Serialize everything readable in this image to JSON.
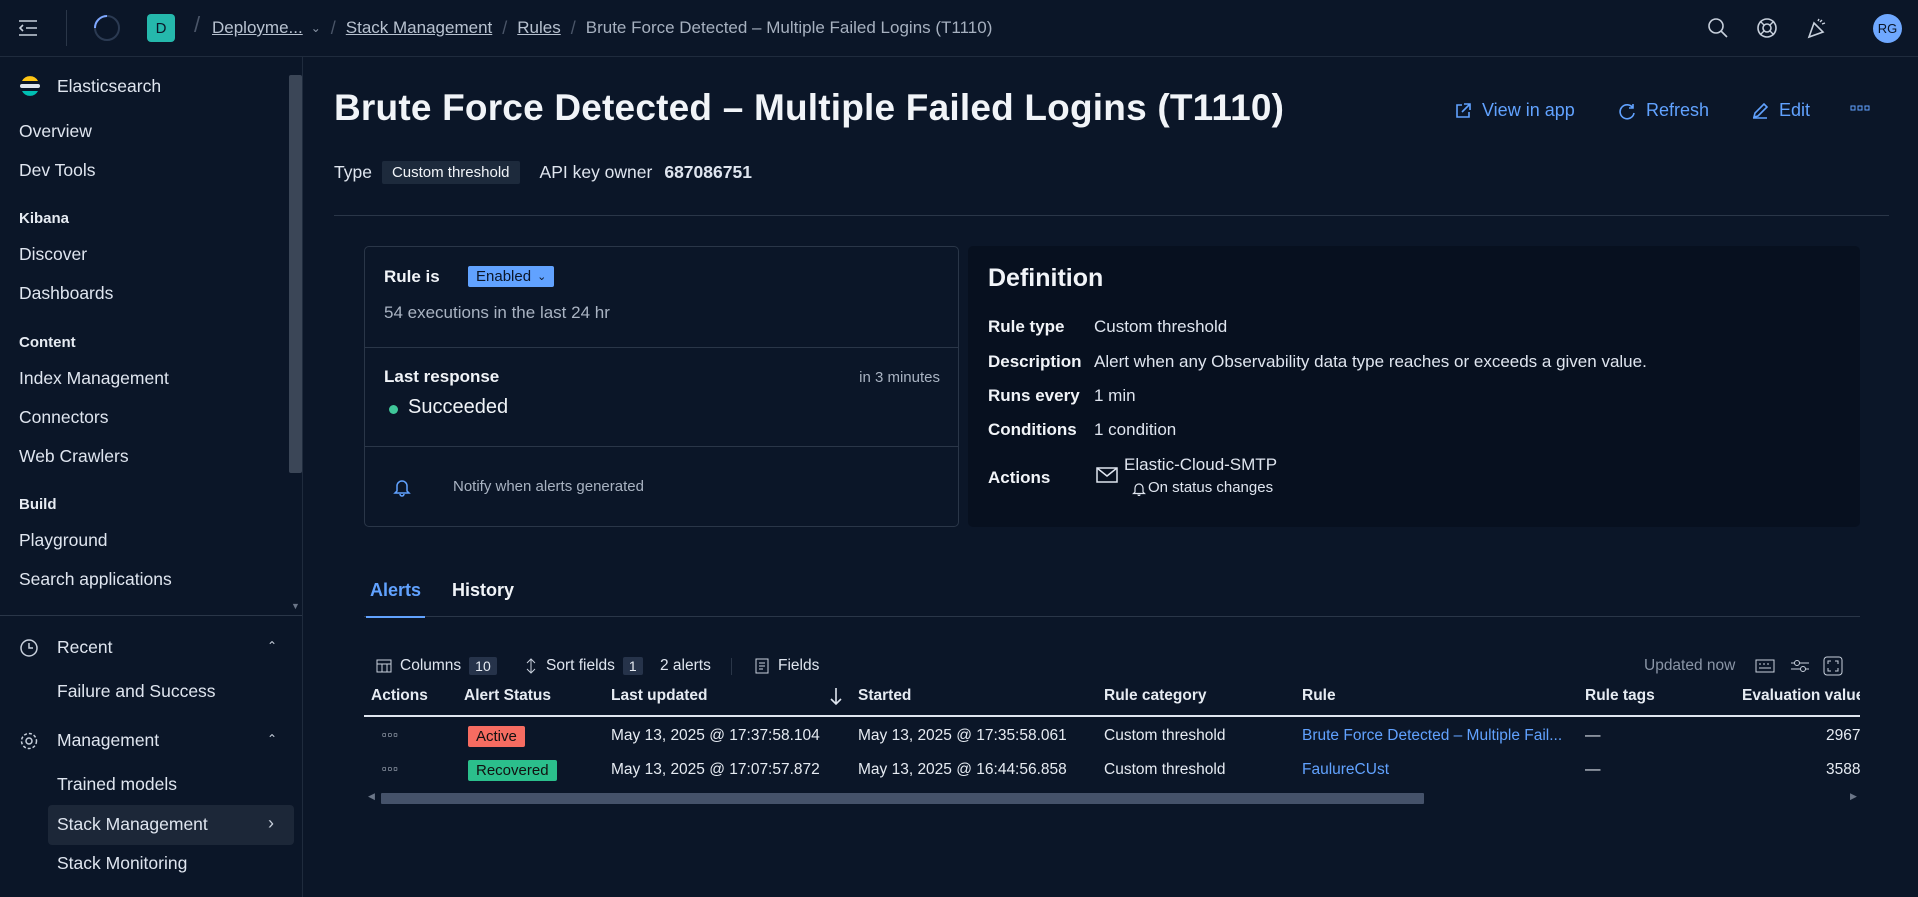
{
  "topbar": {
    "avatar_initial": "D",
    "user_initials": "RG",
    "breadcrumbs": [
      "Deployme...",
      "Stack Management",
      "Rules"
    ],
    "current": "Brute Force Detected – Multiple Failed Logins (T1110)"
  },
  "sidebar": {
    "brand": "Elasticsearch",
    "items_top": [
      "Overview",
      "Dev Tools"
    ],
    "kibana_label": "Kibana",
    "kibana_items": [
      "Discover",
      "Dashboards"
    ],
    "content_label": "Content",
    "content_items": [
      "Index Management",
      "Connectors",
      "Web Crawlers"
    ],
    "build_label": "Build",
    "build_items": [
      "Playground",
      "Search applications"
    ],
    "recent_label": "Recent",
    "recent_items": [
      "Failure and Success"
    ],
    "management_label": "Management",
    "management_items": [
      "Trained models",
      "Stack Management",
      "Stack Monitoring"
    ]
  },
  "header": {
    "title": "Brute Force Detected – Multiple Failed Logins (T1110)",
    "view_in_app": "View in app",
    "refresh": "Refresh",
    "edit": "Edit",
    "type_label": "Type",
    "type_value": "Custom threshold",
    "api_key_label": "API key owner",
    "api_key_value": "687086751"
  },
  "status_panel": {
    "rule_is": "Rule is",
    "enabled": "Enabled",
    "executions": "54 executions in the last 24 hr",
    "last_response": "Last response",
    "next_run": "in 3 minutes",
    "response_status": "Succeeded",
    "notify": "Notify when alerts generated"
  },
  "definition": {
    "title": "Definition",
    "rule_type_label": "Rule type",
    "rule_type": "Custom threshold",
    "description_label": "Description",
    "description": "Alert when any Observability data type reaches or exceeds a given value.",
    "runs_every_label": "Runs every",
    "runs_every": "1 min",
    "conditions_label": "Conditions",
    "conditions": "1 condition",
    "actions_label": "Actions",
    "action_connector": "Elastic-Cloud-SMTP",
    "action_frequency": "On status changes"
  },
  "tabs": [
    "Alerts",
    "History"
  ],
  "toolbar": {
    "columns": "Columns",
    "columns_count": "10",
    "sort_fields": "Sort fields",
    "sort_count": "1",
    "alerts_count": "2 alerts",
    "fields": "Fields",
    "updated": "Updated now"
  },
  "table": {
    "headers": [
      "Actions",
      "Alert Status",
      "Last updated",
      "Started",
      "Rule category",
      "Rule",
      "Rule tags",
      "Evaluation values"
    ],
    "rows": [
      {
        "status": "Active",
        "last_updated": "May 13, 2025 @ 17:37:58.104",
        "started": "May 13, 2025 @ 17:35:58.061",
        "category": "Custom threshold",
        "rule": "Brute Force Detected – Multiple Fail...",
        "tags": "—",
        "eval": "2967"
      },
      {
        "status": "Recovered",
        "last_updated": "May 13, 2025 @ 17:07:57.872",
        "started": "May 13, 2025 @ 16:44:56.858",
        "category": "Custom threshold",
        "rule": "FaulureCUst",
        "tags": "—",
        "eval": "3588"
      }
    ]
  },
  "colors": {
    "accent": "#61a2ff",
    "active": "#f66c61",
    "recovered": "#2bbf8c",
    "success_dot": "#40c79a"
  }
}
